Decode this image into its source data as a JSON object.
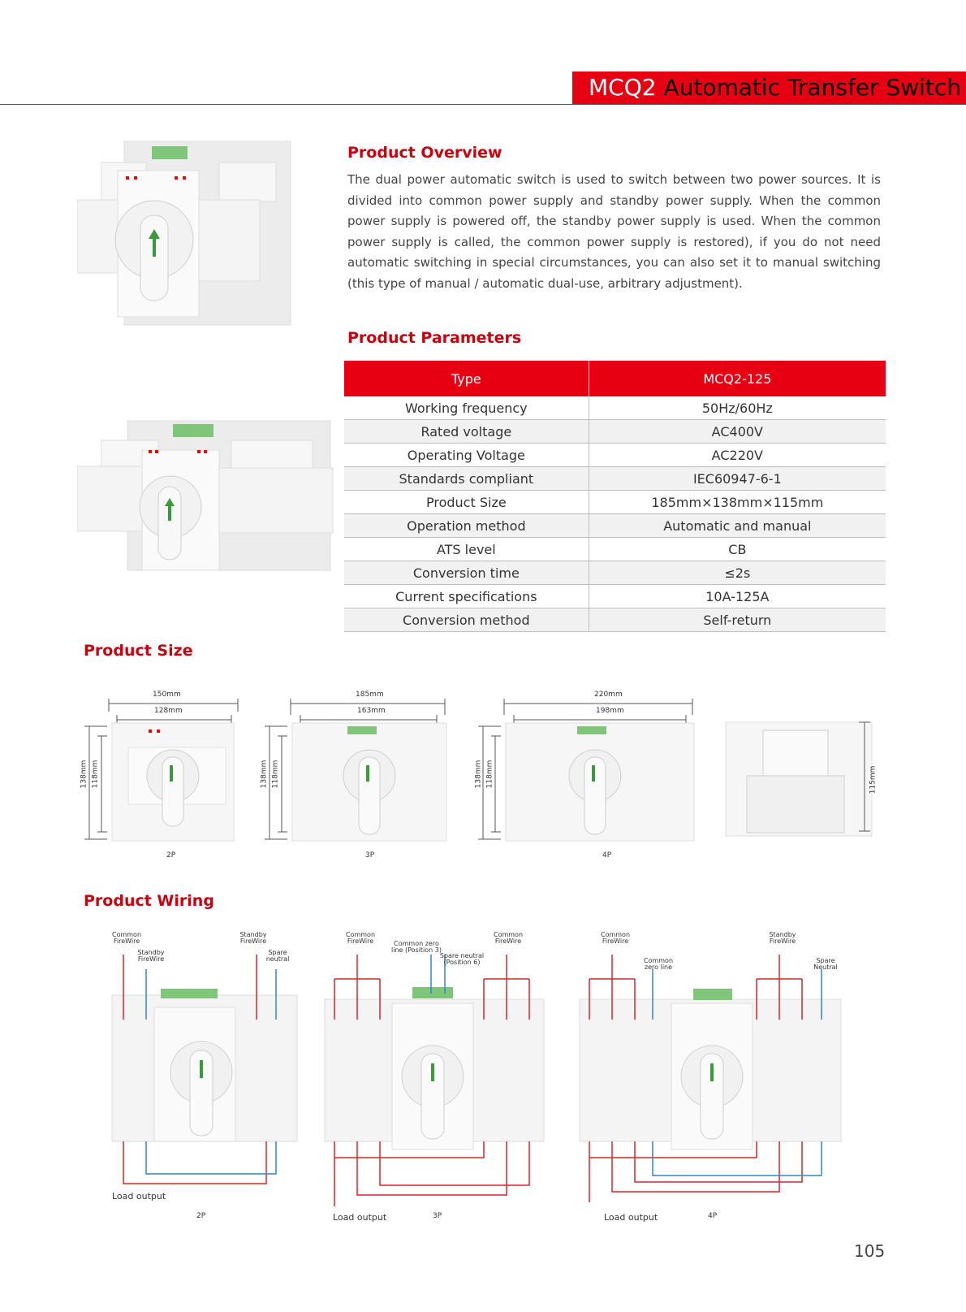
{
  "header": {
    "model": "MCQ2",
    "title_rest": "Automatic Transfer Switch"
  },
  "overview": {
    "heading": "Product Overview",
    "text": "The dual power automatic switch is used to switch between two power sources. It is divided into common power supply and standby power supply. When the common power supply is powered off, the standby power supply is used. When the common power supply is called, the common power supply is restored), if you do not need automatic switching in special circumstances, you can also set it to manual switching (this type of manual / automatic dual-use, arbitrary adjustment)."
  },
  "parameters": {
    "heading": "Product Parameters",
    "header": [
      "Type",
      "MCQ2-125"
    ],
    "rows": [
      [
        "Working frequency",
        "50Hz/60Hz"
      ],
      [
        "Rated voltage",
        "AC400V"
      ],
      [
        "Operating Voltage",
        "AC220V"
      ],
      [
        "Standards compliant",
        "IEC60947-6-1"
      ],
      [
        "Product Size",
        "185mm×138mm×115mm"
      ],
      [
        "Operation method",
        "Automatic and manual"
      ],
      [
        "ATS level",
        "CB"
      ],
      [
        "Conversion time",
        "≤2s"
      ],
      [
        "Current specifications",
        "10A-125A"
      ],
      [
        "Conversion method",
        "Self-return"
      ]
    ]
  },
  "size": {
    "heading": "Product Size",
    "views": [
      {
        "caption": "2P",
        "outer_width": "150mm",
        "inner_width": "128mm",
        "outer_height": "138mm",
        "inner_height": "118mm"
      },
      {
        "caption": "3P",
        "outer_width": "185mm",
        "inner_width": "163mm",
        "outer_height": "138mm",
        "inner_height": "118mm"
      },
      {
        "caption": "4P",
        "outer_width": "220mm",
        "inner_width": "198mm",
        "outer_height": "138mm",
        "inner_height": "118mm"
      }
    ],
    "side_depth": "115mm"
  },
  "wiring": {
    "heading": "Product Wiring",
    "diagrams": [
      {
        "caption": "2P",
        "labels": [
          "Common FireWire",
          "Standby FireWire",
          "Standby FireWire",
          "Spare neutral"
        ],
        "load": "Load output"
      },
      {
        "caption": "3P",
        "labels": [
          "Common FireWire",
          "Common zero line (Position 3)",
          "Spare neutral (Position 6)",
          "Common FireWire"
        ],
        "load": "Load output"
      },
      {
        "caption": "4P",
        "labels": [
          "Common FireWire",
          "Common zero line",
          "Standby FireWire",
          "Spare Neutral"
        ],
        "load": "Load output"
      }
    ]
  },
  "page_number": "105",
  "colors": {
    "accent": "#e60012",
    "heading": "#c8000f",
    "wire_red": "#d7262b",
    "wire_blue": "#2e86c9"
  }
}
